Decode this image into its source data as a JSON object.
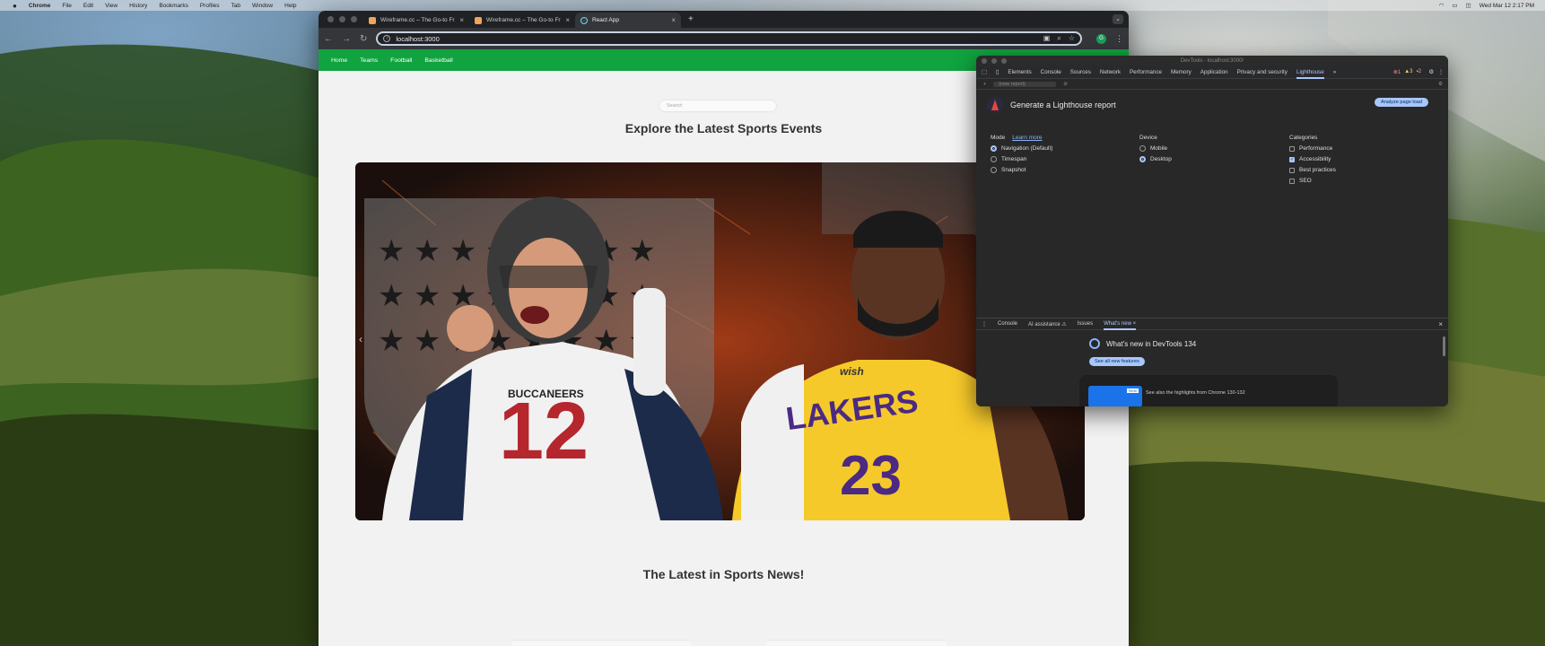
{
  "menubar": {
    "items": [
      "Chrome",
      "File",
      "Edit",
      "View",
      "History",
      "Bookmarks",
      "Profiles",
      "Tab",
      "Window",
      "Help"
    ],
    "clock": "Wed Mar 12  2:17 PM"
  },
  "browser": {
    "tabs": [
      {
        "title": "Wireframe.cc – The Go-to Fr..."
      },
      {
        "title": "Wireframe.cc – The Go-to Fr..."
      },
      {
        "title": "React App"
      }
    ],
    "url": "localhost:3000"
  },
  "site": {
    "nav": [
      "Home",
      "Teams",
      "Football",
      "Basketball"
    ],
    "search_placeholder": "Search",
    "heading": "Explore the Latest Sports Events",
    "news_heading": "The Latest in Sports News!",
    "hero": {
      "left_number": "12",
      "left_team": "BUCCANEERS",
      "right_team": "LAKERS",
      "right_number": "23",
      "sponsor": "wish"
    }
  },
  "devtools": {
    "title": "DevTools - localhost:3000/",
    "tabs": [
      "Elements",
      "Console",
      "Sources",
      "Network",
      "Performance",
      "Memory",
      "Application",
      "Privacy and security",
      "Lighthouse"
    ],
    "selected_tab": "Lighthouse",
    "errors": {
      "red": "1",
      "yellow": "3",
      "orange": "2"
    },
    "report_select": "(new report)",
    "lighthouse_title": "Generate a Lighthouse report",
    "analyze_button": "Analyze page load",
    "mode": {
      "label": "Mode",
      "learn_more": "Learn more",
      "options": [
        "Navigation (Default)",
        "Timespan",
        "Snapshot"
      ]
    },
    "device": {
      "label": "Device",
      "options": [
        "Mobile",
        "Desktop"
      ]
    },
    "categories": {
      "label": "Categories",
      "options": [
        "Performance",
        "Accessibility",
        "Best practices",
        "SEO"
      ]
    },
    "drawer": {
      "tabs": [
        "Console",
        "AI assistance ⚠",
        "Issues",
        "What's new"
      ],
      "whats_new": "What's new in DevTools 134",
      "see_all": "See all new features",
      "promo_text": "See also the highlights from Chrome 130-132",
      "promo_badge": "New"
    }
  },
  "colors": {
    "nav_green": "#10a33f",
    "devtools_accent": "#a8c7fa"
  }
}
